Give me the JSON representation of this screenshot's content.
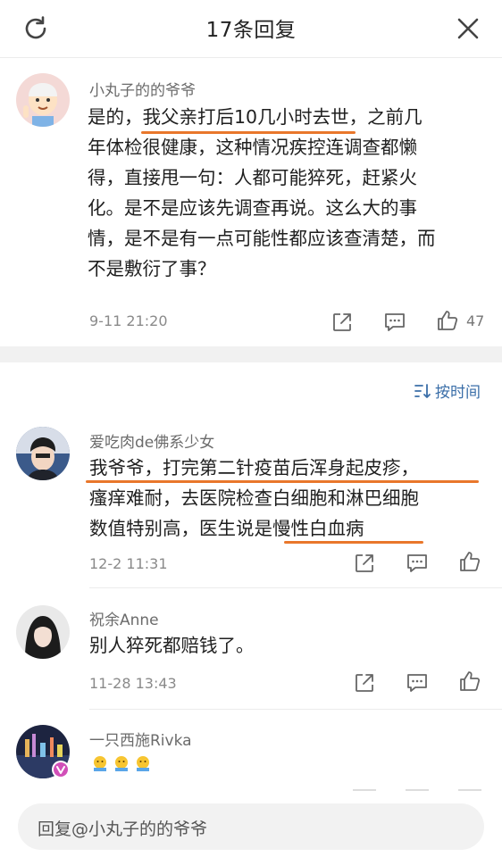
{
  "header": {
    "title": "17条回复"
  },
  "main_comment": {
    "username": "小丸子的的爷爷",
    "lines": [
      "是的，我父亲打后10几小时去世，之前几",
      "年体检很健康，这种情况疾控连调查都懒",
      "得，直接甩一句：人都可能猝死，赶紧火",
      "化。是不是应该先调查再说。这么大的事",
      "情，是不是有一点可能性都应该查清楚，而",
      "不是敷衍了事？"
    ],
    "time": "9-11 21:20",
    "likes": "47"
  },
  "sort": {
    "label": "按时间"
  },
  "replies": [
    {
      "username": "爱吃肉de佛系少女",
      "lines": [
        "我爷爷，打完第二针疫苗后浑身起皮疹，",
        "瘙痒难耐，去医院检查白细胞和淋巴细胞",
        "数值特别高，医生说是慢性白血病"
      ],
      "time": "12-2 11:31"
    },
    {
      "username": "祝余Anne",
      "lines": [
        "别人猝死都赔钱了。"
      ],
      "time": "11-28 13:43"
    },
    {
      "username": "一只西施Rivka",
      "lines": [],
      "time": ""
    }
  ],
  "reply_bar": {
    "placeholder": "回复@小丸子的的爷爷"
  },
  "colors": {
    "accent_underline": "#e9772b",
    "link": "#3a6ea8"
  },
  "icons": [
    "refresh-icon",
    "close-icon",
    "share-icon",
    "comment-icon",
    "like-icon",
    "sort-icon",
    "verified-badge-icon",
    "emoji-icon"
  ]
}
